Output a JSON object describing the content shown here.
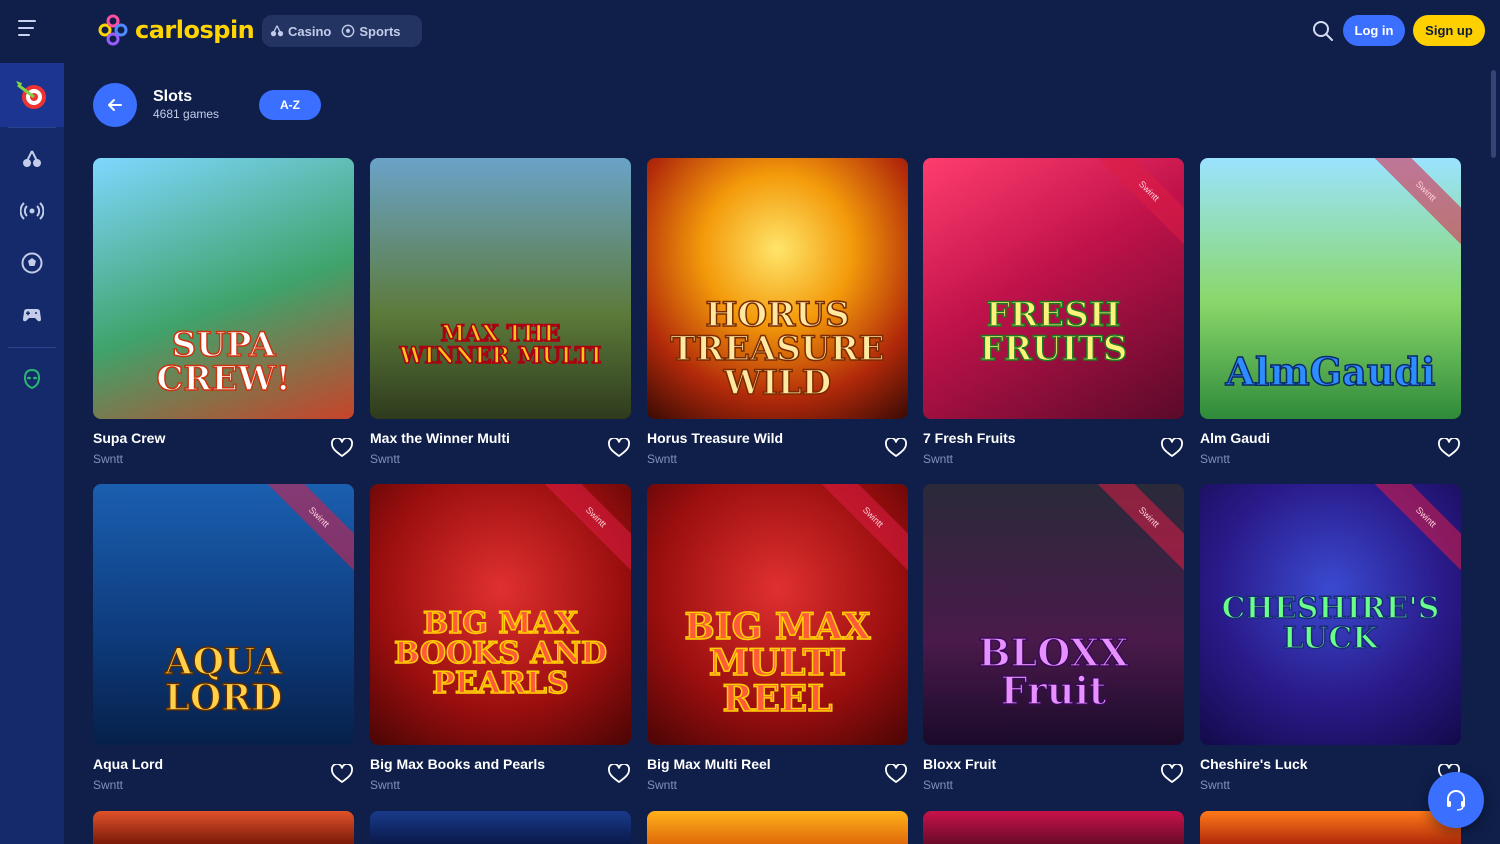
{
  "brand": {
    "name": "carlospin",
    "accent": "#ffd400",
    "primary": "#3b6fff",
    "background": "#0f1f4a"
  },
  "nav": {
    "casino_label": "Casino",
    "sports_label": "Sports"
  },
  "auth": {
    "login_label": "Log in",
    "signup_label": "Sign up"
  },
  "sidebar": {
    "items": [
      {
        "icon": "target-promo-icon"
      },
      {
        "icon": "cherries-icon"
      },
      {
        "icon": "live-broadcast-icon"
      },
      {
        "icon": "football-icon"
      },
      {
        "icon": "gamepad-icon"
      },
      {
        "icon": "alien-icon"
      }
    ]
  },
  "section": {
    "title": "Slots",
    "count": "4681 games",
    "sort_label": "A-Z"
  },
  "games": [
    {
      "name": "Supa Crew",
      "provider": "Swntt",
      "art": "SUPA CREW!"
    },
    {
      "name": "Max the Winner Multi",
      "provider": "Swntt",
      "art": "MAX THE WINNER MULTI"
    },
    {
      "name": "Horus Treasure Wild",
      "provider": "Swntt",
      "art": "HORUS TREASURE WILD"
    },
    {
      "name": "7 Fresh Fruits",
      "provider": "Swntt",
      "art": "FRESH FRUITS"
    },
    {
      "name": "Alm Gaudi",
      "provider": "Swntt",
      "art": "AlmGaudi"
    },
    {
      "name": "Aqua Lord",
      "provider": "Swntt",
      "art": "AQUA LORD"
    },
    {
      "name": "Big Max Books and Pearls",
      "provider": "Swntt",
      "art": "BIG MAX BOOKS AND PEARLS"
    },
    {
      "name": "Big Max Multi Reel",
      "provider": "Swntt",
      "art": "BIG MAX MULTI REEL"
    },
    {
      "name": "Bloxx Fruit",
      "provider": "Swntt",
      "art": "BLOXX Fruit"
    },
    {
      "name": "Cheshire's Luck",
      "provider": "Swntt",
      "art": "CHESHIRE'S LUCK"
    }
  ],
  "ribbon_text": "Swintt"
}
